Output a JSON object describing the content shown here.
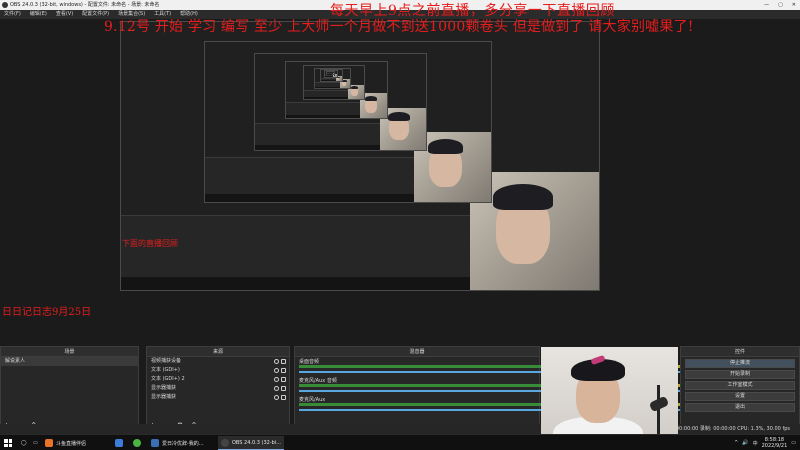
{
  "window": {
    "title": "OBS 24.0.3 (32-bit, windows) - 配置文件: 未命名 - 场景: 未命名",
    "controls": [
      "—",
      "▢",
      "✕"
    ]
  },
  "menu": [
    "文件(F)",
    "编辑(E)",
    "查看(V)",
    "配置文件(P)",
    "场景集合(S)",
    "工具(T)",
    "帮助(H)"
  ],
  "overlay": {
    "banner1": "每天早上9点之前直播，多分享一下直播回顾",
    "banner2": "9.12号 开始 学习 编写 至少 上大师一个月做不到送1000颗卷头 但是做到了 请大家别嘘果了!",
    "side1": "下面的直播回顾",
    "side2": "日日记日志9月25日"
  },
  "docks": {
    "scenes": {
      "title": "场景",
      "items": [
        "解说素人"
      ]
    },
    "sources": {
      "title": "来源",
      "items": [
        "视频捕获设备",
        "文本 (GDI+)",
        "文本 (GDI+) 2",
        "显示器捕获",
        "显示器捕获"
      ]
    },
    "mixer": {
      "title": "混音器",
      "channels": [
        {
          "name": "桌面音频",
          "level": 0.93
        },
        {
          "name": "麦克风/Aux 音频",
          "level": 0.93
        },
        {
          "name": "麦克风/Aux",
          "level": 0.93
        }
      ]
    },
    "controls": {
      "title": "控件",
      "buttons": [
        "停止推流",
        "开始录制",
        "工作室模式",
        "设置",
        "退出"
      ]
    }
  },
  "status": "直播: 00:00:00    录制: 00:00:00    CPU: 1.3%, 30.00 fps",
  "taskbar": {
    "apps": [
      {
        "label": "斗鱼直播伴侣",
        "color": "#e8742a"
      },
      {
        "label": "",
        "color": "#3b7dd8"
      },
      {
        "label": "",
        "color": "#4bb543"
      },
      {
        "label": "爱日冷优辞-我的...",
        "color": "#3a6fb5"
      },
      {
        "label": "OBS 24.0.3 (32-bi...",
        "color": "#444444"
      }
    ],
    "tray_icons": [
      "^",
      "🔊",
      "中"
    ],
    "time": "8:58:18",
    "date": "2022/9/21"
  }
}
